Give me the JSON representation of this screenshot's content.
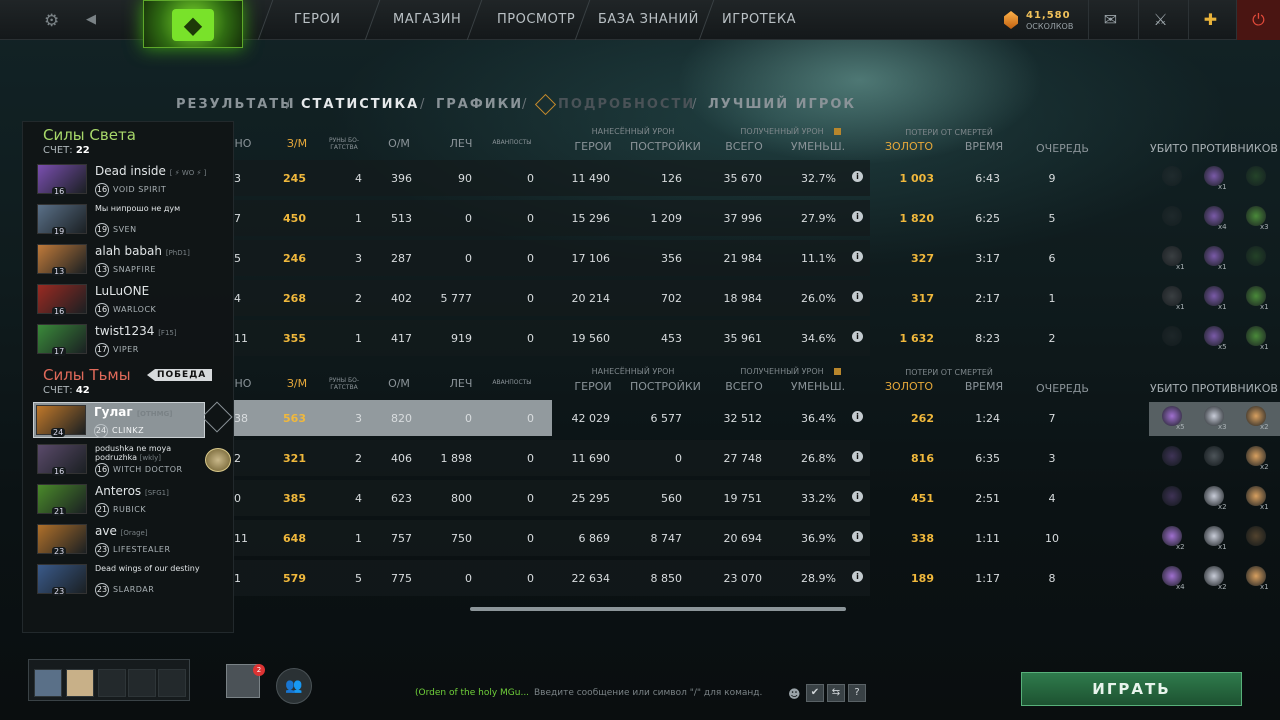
{
  "topbar": {
    "nav": [
      "ГЕРОИ",
      "МАГАЗИН",
      "ПРОСМОТР",
      "БАЗА ЗНАНИЙ",
      "ИГРОТЕКА"
    ],
    "shards_amount": "41,580",
    "shards_label": "ОСКОЛКОВ"
  },
  "tabs": {
    "results": "РЕЗУЛЬТАТЫ",
    "stats": "СТАТИСТИКА",
    "graphs": "ГРАФИКИ",
    "details": "ПОДРОБНОСТИ",
    "best": "ЛУЧШИЙ ИГРОК",
    "sep": "/"
  },
  "radiant": {
    "name": "Силы Света",
    "score_label": "СЧЕТ:",
    "score": "22"
  },
  "dire": {
    "name": "Силы Тьмы",
    "score_label": "СЧЕТ:",
    "score": "42",
    "win": "ПОБЕДА"
  },
  "players": [
    {
      "name": "Dead inside",
      "tag": "[ ⚡ WO ⚡ ]",
      "level": "16",
      "hero": "VOID SPIRIT",
      "color": "#7a4fb0"
    },
    {
      "name": "Мы нипрошо не дум",
      "tag": "",
      "level": "19",
      "hero": "SVEN",
      "color": "#5a7088"
    },
    {
      "name": "alah babah",
      "tag": "[PhD1]",
      "level": "13",
      "hero": "SNAPFIRE",
      "color": "#c07a3a"
    },
    {
      "name": "LuLuONE",
      "tag": "",
      "level": "16",
      "hero": "WARLOCK",
      "color": "#9a2a22"
    },
    {
      "name": "twist1234",
      "tag": "[F15]",
      "level": "17",
      "hero": "VIPER",
      "color": "#3a8a3a"
    },
    {
      "name": "Гулаг",
      "tag": "[OTHMG]",
      "level": "24",
      "hero": "CLINKZ",
      "color": "#c0782a"
    },
    {
      "name": "podushka ne moya podruzhka",
      "tag": "[wkly]",
      "level": "16",
      "hero": "WITCH DOCTOR",
      "color": "#5a4a6a"
    },
    {
      "name": "Anteros",
      "tag": "[SFG1]",
      "level": "21",
      "hero": "RUBICK",
      "color": "#4a8a2a"
    },
    {
      "name": "ave",
      "tag": "[Orage]",
      "level": "23",
      "hero": "LIFESTEALER",
      "color": "#b0702a"
    },
    {
      "name": "Dead wings of our destiny",
      "tag": "",
      "level": "23",
      "hero": "SLARDAR",
      "color": "#3a5a8a"
    }
  ],
  "headers": {
    "col0": "НО",
    "nw": "З/М",
    "runes": "РУНЫ БО-ГАТСТВА",
    "xpm": "О/М",
    "heal": "ЛЕЧ",
    "wards": "АВАНПОСТЫ",
    "dmg_group": "НАНЕСЁННЫЙ УРОН",
    "heroes": "ГЕРОИ",
    "buildings": "ПОСТРОЙКИ",
    "recv_group": "ПОЛУЧЕННЫЙ УРОН",
    "total": "ВСЕГО",
    "reduced": "УМЕНЬШ.",
    "death_group": "ПОТЕРИ ОТ СМЕРТЕЙ",
    "gold": "ЗОЛОТО",
    "time": "ВРЕМЯ",
    "turn": "ОЧЕРЕДЬ",
    "killed": "УБИТО ПРОТИВНИКОВ"
  },
  "rows": [
    {
      "c0": "3",
      "gpm": "245",
      "runes": "4",
      "xpm": "396",
      "heal": "90",
      "wards": "0",
      "hd": "11 490",
      "bd": "126",
      "recv": "35 670",
      "red": "32.7%",
      "gold": "1 003",
      "time": "6:43",
      "turn": "9"
    },
    {
      "c0": "7",
      "gpm": "450",
      "runes": "1",
      "xpm": "513",
      "heal": "0",
      "wards": "0",
      "hd": "15 296",
      "bd": "1 209",
      "recv": "37 996",
      "red": "27.9%",
      "gold": "1 820",
      "time": "6:25",
      "turn": "5"
    },
    {
      "c0": "5",
      "gpm": "246",
      "runes": "3",
      "xpm": "287",
      "heal": "0",
      "wards": "0",
      "hd": "17 106",
      "bd": "356",
      "recv": "21 984",
      "red": "11.1%",
      "gold": "327",
      "time": "3:17",
      "turn": "6"
    },
    {
      "c0": "4",
      "gpm": "268",
      "runes": "2",
      "xpm": "402",
      "heal": "5 777",
      "wards": "0",
      "hd": "20 214",
      "bd": "702",
      "recv": "18 984",
      "red": "26.0%",
      "gold": "317",
      "time": "2:17",
      "turn": "1"
    },
    {
      "c0": "11",
      "gpm": "355",
      "runes": "1",
      "xpm": "417",
      "heal": "919",
      "wards": "0",
      "hd": "19 560",
      "bd": "453",
      "recv": "35 961",
      "red": "34.6%",
      "gold": "1 632",
      "time": "8:23",
      "turn": "2"
    },
    {
      "c0": "38",
      "gpm": "563",
      "runes": "3",
      "xpm": "820",
      "heal": "0",
      "wards": "0",
      "hd": "42 029",
      "bd": "6 577",
      "recv": "32 512",
      "red": "36.4%",
      "gold": "262",
      "time": "1:24",
      "turn": "7"
    },
    {
      "c0": "2",
      "gpm": "321",
      "runes": "2",
      "xpm": "406",
      "heal": "1 898",
      "wards": "0",
      "hd": "11 690",
      "bd": "0",
      "recv": "27 748",
      "red": "26.8%",
      "gold": "816",
      "time": "6:35",
      "turn": "3"
    },
    {
      "c0": "0",
      "gpm": "385",
      "runes": "4",
      "xpm": "623",
      "heal": "800",
      "wards": "0",
      "hd": "25 295",
      "bd": "560",
      "recv": "19 751",
      "red": "33.2%",
      "gold": "451",
      "time": "2:51",
      "turn": "4"
    },
    {
      "c0": "11",
      "gpm": "648",
      "runes": "1",
      "xpm": "757",
      "heal": "750",
      "wards": "0",
      "hd": "6 869",
      "bd": "8 747",
      "recv": "20 694",
      "red": "36.9%",
      "gold": "338",
      "time": "1:11",
      "turn": "10"
    },
    {
      "c0": "1",
      "gpm": "579",
      "runes": "5",
      "xpm": "775",
      "heal": "0",
      "wards": "0",
      "hd": "22 634",
      "bd": "8 850",
      "recv": "23 070",
      "red": "28.9%",
      "gold": "189",
      "time": "1:17",
      "turn": "8"
    }
  ],
  "kills": [
    [
      "",
      "x1",
      ""
    ],
    [
      "",
      "x4",
      "x3"
    ],
    [
      "x1",
      "x1",
      ""
    ],
    [
      "x1",
      "x1",
      "x1"
    ],
    [
      "",
      "x5",
      "x1"
    ],
    [
      "x5",
      "x3",
      "x2"
    ],
    [
      "",
      "",
      "x2"
    ],
    [
      "",
      "x2",
      "x1"
    ],
    [
      "x2",
      "x1",
      ""
    ],
    [
      "x4",
      "x2",
      "x1"
    ]
  ],
  "bottom": {
    "party_badge": "2",
    "channel": "(Orden of the holy MGu...",
    "chat_placeholder": "Введите сообщение или символ \"/\" для команд.",
    "play": "ИГРАТЬ",
    "help": "?"
  },
  "icons": {
    "settings": "⚙",
    "back": "◀",
    "mail": "✉",
    "armory": "⚔",
    "power": "⏻",
    "plus": "✚",
    "info": "i",
    "emoji": "☻",
    "check": "✔",
    "group": "👥"
  }
}
